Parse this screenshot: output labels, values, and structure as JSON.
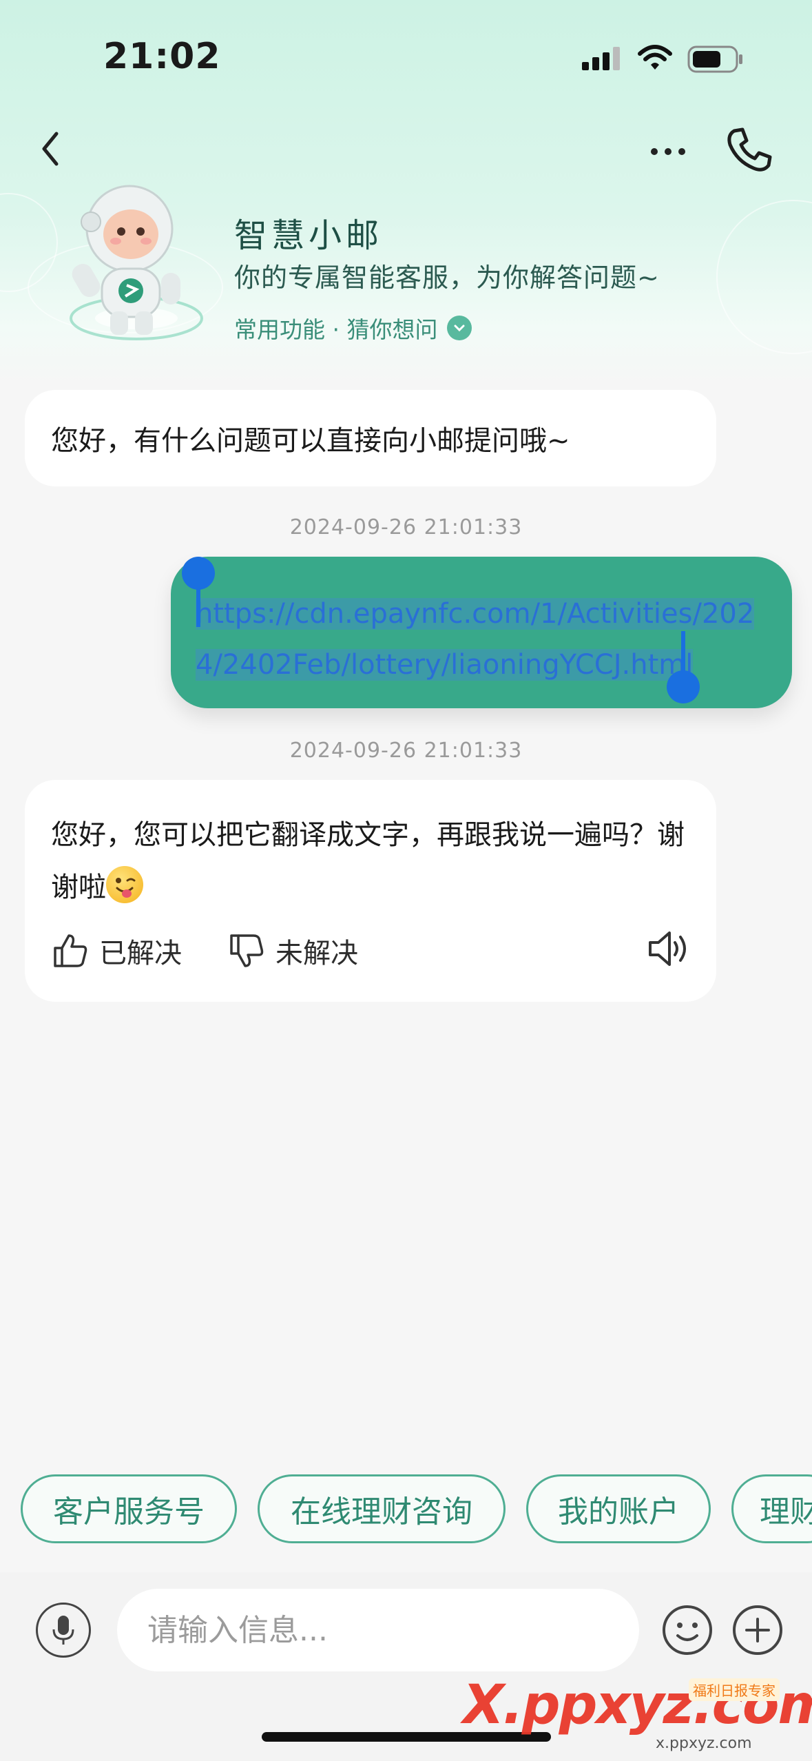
{
  "status_bar": {
    "time": "21:02"
  },
  "header": {
    "bot_name": "智慧小邮",
    "bot_subtitle": "你的专属智能客服，为你解答问题~",
    "quick_functions": "常用功能 · 猜你想问"
  },
  "messages": [
    {
      "sender": "bot",
      "text": "您好，有什么问题可以直接向小邮提问哦~"
    },
    {
      "timestamp": "2024-09-26 21:01:33",
      "sender": "user",
      "text": "https://cdn.epaynfc.com/1/Activities/2024/2402Feb/lottery/liaoningYCCJ.html",
      "selected": true
    },
    {
      "timestamp": "2024-09-26 21:01:33",
      "sender": "bot",
      "text": "您好，您可以把它翻译成文字，再跟我说一遍吗？谢谢啦",
      "emoji": "winking-tongue-emoji",
      "feedback": {
        "resolved_label": "已解决",
        "unresolved_label": "未解决"
      }
    }
  ],
  "quick_chips": [
    "客户服务号",
    "在线理财咨询",
    "我的账户",
    "理财"
  ],
  "input": {
    "placeholder": "请输入信息..."
  },
  "watermark": {
    "brand": "X.ppxyz.com",
    "small": "x.ppxyz.com",
    "tag": "福利日报专家"
  },
  "colors": {
    "accent": "#38a98a",
    "chip_border": "#4fae93",
    "selection": "#1a6fe0",
    "header_bg": "#cdf2e4"
  }
}
